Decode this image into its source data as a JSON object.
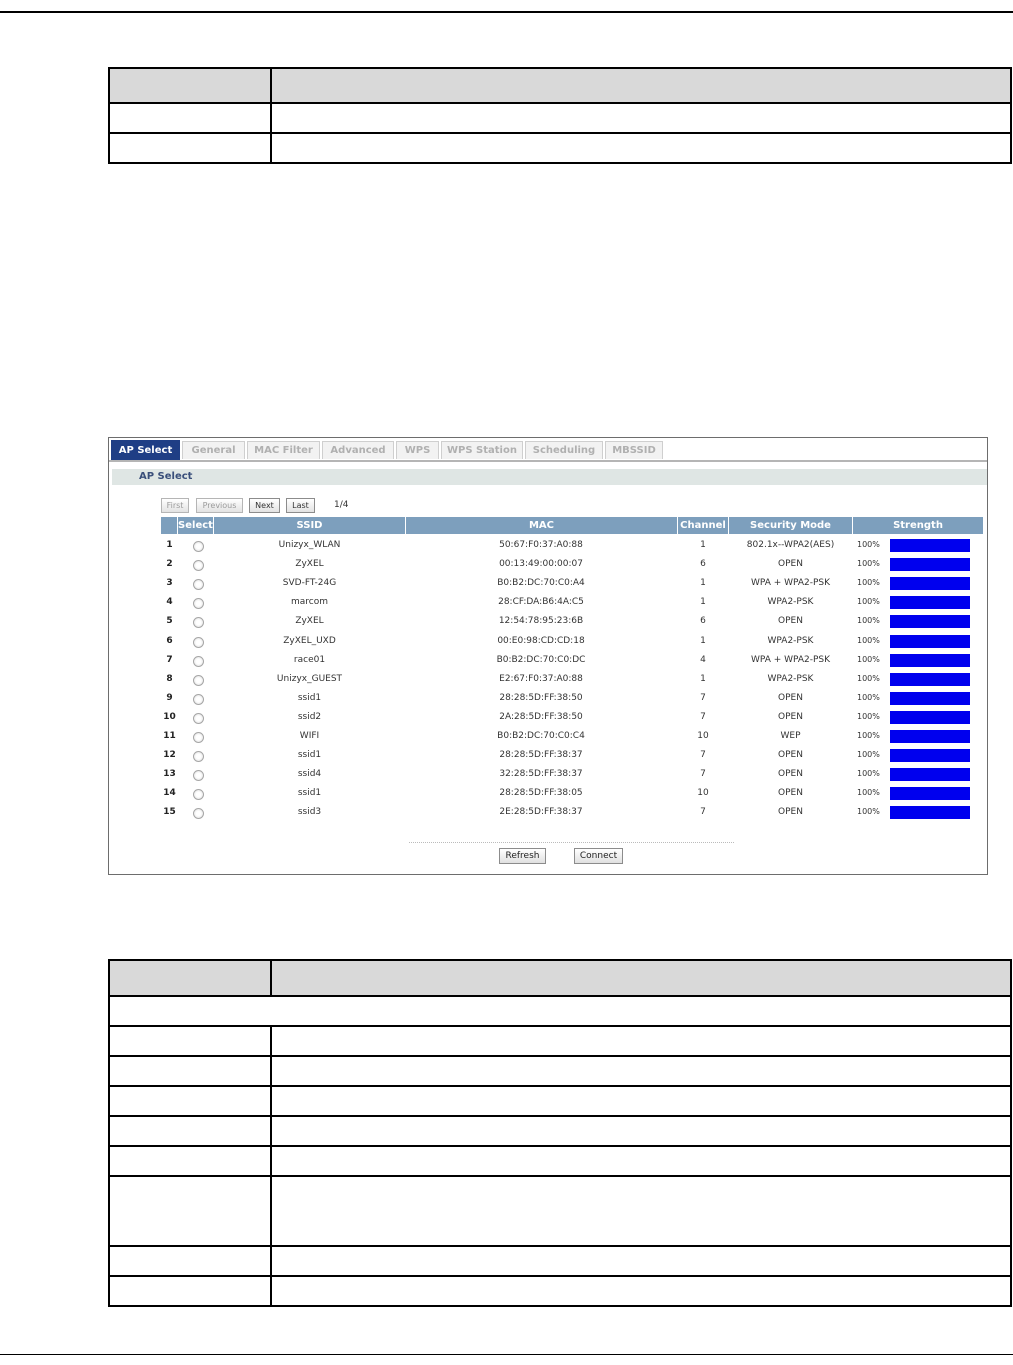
{
  "doc_table_1": {
    "rows": 3
  },
  "tabs": [
    "AP Select",
    "General",
    "MAC Filter",
    "Advanced",
    "WPS",
    "WPS Station",
    "Scheduling",
    "MBSSID"
  ],
  "section_title": "AP Select",
  "pager": {
    "first": "First",
    "previous": "Previous",
    "next": "Next",
    "last": "Last",
    "page": "1/4"
  },
  "columns": {
    "select": "Select",
    "ssid": "SSID",
    "mac": "MAC",
    "channel": "Channel",
    "security": "Security Mode",
    "strength": "Strength"
  },
  "ap_list": [
    {
      "num": "1",
      "ssid": "Unizyx_WLAN",
      "mac": "50:67:F0:37:A0:88",
      "channel": "1",
      "security": "802.1x--WPA2(AES)",
      "strength": "100%",
      "level": 100
    },
    {
      "num": "2",
      "ssid": "ZyXEL",
      "mac": "00:13:49:00:00:07",
      "channel": "6",
      "security": "OPEN",
      "strength": "100%",
      "level": 100
    },
    {
      "num": "3",
      "ssid": "SVD-FT-24G",
      "mac": "B0:B2:DC:70:C0:A4",
      "channel": "1",
      "security": "WPA + WPA2-PSK",
      "strength": "100%",
      "level": 100
    },
    {
      "num": "4",
      "ssid": "marcom",
      "mac": "28:CF:DA:B6:4A:C5",
      "channel": "1",
      "security": "WPA2-PSK",
      "strength": "100%",
      "level": 100
    },
    {
      "num": "5",
      "ssid": "ZyXEL",
      "mac": "12:54:78:95:23:6B",
      "channel": "6",
      "security": "OPEN",
      "strength": "100%",
      "level": 100
    },
    {
      "num": "6",
      "ssid": "ZyXEL_UXD",
      "mac": "00:E0:98:CD:CD:18",
      "channel": "1",
      "security": "WPA2-PSK",
      "strength": "100%",
      "level": 100
    },
    {
      "num": "7",
      "ssid": "race01",
      "mac": "B0:B2:DC:70:C0:DC",
      "channel": "4",
      "security": "WPA + WPA2-PSK",
      "strength": "100%",
      "level": 100
    },
    {
      "num": "8",
      "ssid": "Unizyx_GUEST",
      "mac": "E2:67:F0:37:A0:88",
      "channel": "1",
      "security": "WPA2-PSK",
      "strength": "100%",
      "level": 100
    },
    {
      "num": "9",
      "ssid": "ssid1",
      "mac": "28:28:5D:FF:38:50",
      "channel": "7",
      "security": "OPEN",
      "strength": "100%",
      "level": 100
    },
    {
      "num": "10",
      "ssid": "ssid2",
      "mac": "2A:28:5D:FF:38:50",
      "channel": "7",
      "security": "OPEN",
      "strength": "100%",
      "level": 100
    },
    {
      "num": "11",
      "ssid": "WIFI",
      "mac": "B0:B2:DC:70:C0:C4",
      "channel": "10",
      "security": "WEP",
      "strength": "100%",
      "level": 100
    },
    {
      "num": "12",
      "ssid": "ssid1",
      "mac": "28:28:5D:FF:38:37",
      "channel": "7",
      "security": "OPEN",
      "strength": "100%",
      "level": 100
    },
    {
      "num": "13",
      "ssid": "ssid4",
      "mac": "32:28:5D:FF:38:37",
      "channel": "7",
      "security": "OPEN",
      "strength": "100%",
      "level": 100
    },
    {
      "num": "14",
      "ssid": "ssid1",
      "mac": "28:28:5D:FF:38:05",
      "channel": "10",
      "security": "OPEN",
      "strength": "100%",
      "level": 100
    },
    {
      "num": "15",
      "ssid": "ssid3",
      "mac": "2E:28:5D:FF:38:37",
      "channel": "7",
      "security": "OPEN",
      "strength": "100%",
      "level": 100
    }
  ],
  "buttons": {
    "refresh": "Refresh",
    "connect": "Connect"
  },
  "colors": {
    "tab_active": "#1f3e85",
    "header_bg": "#7d9fbd",
    "strength_bar": "#0000ee",
    "doc_header": "#d9d9d9"
  }
}
